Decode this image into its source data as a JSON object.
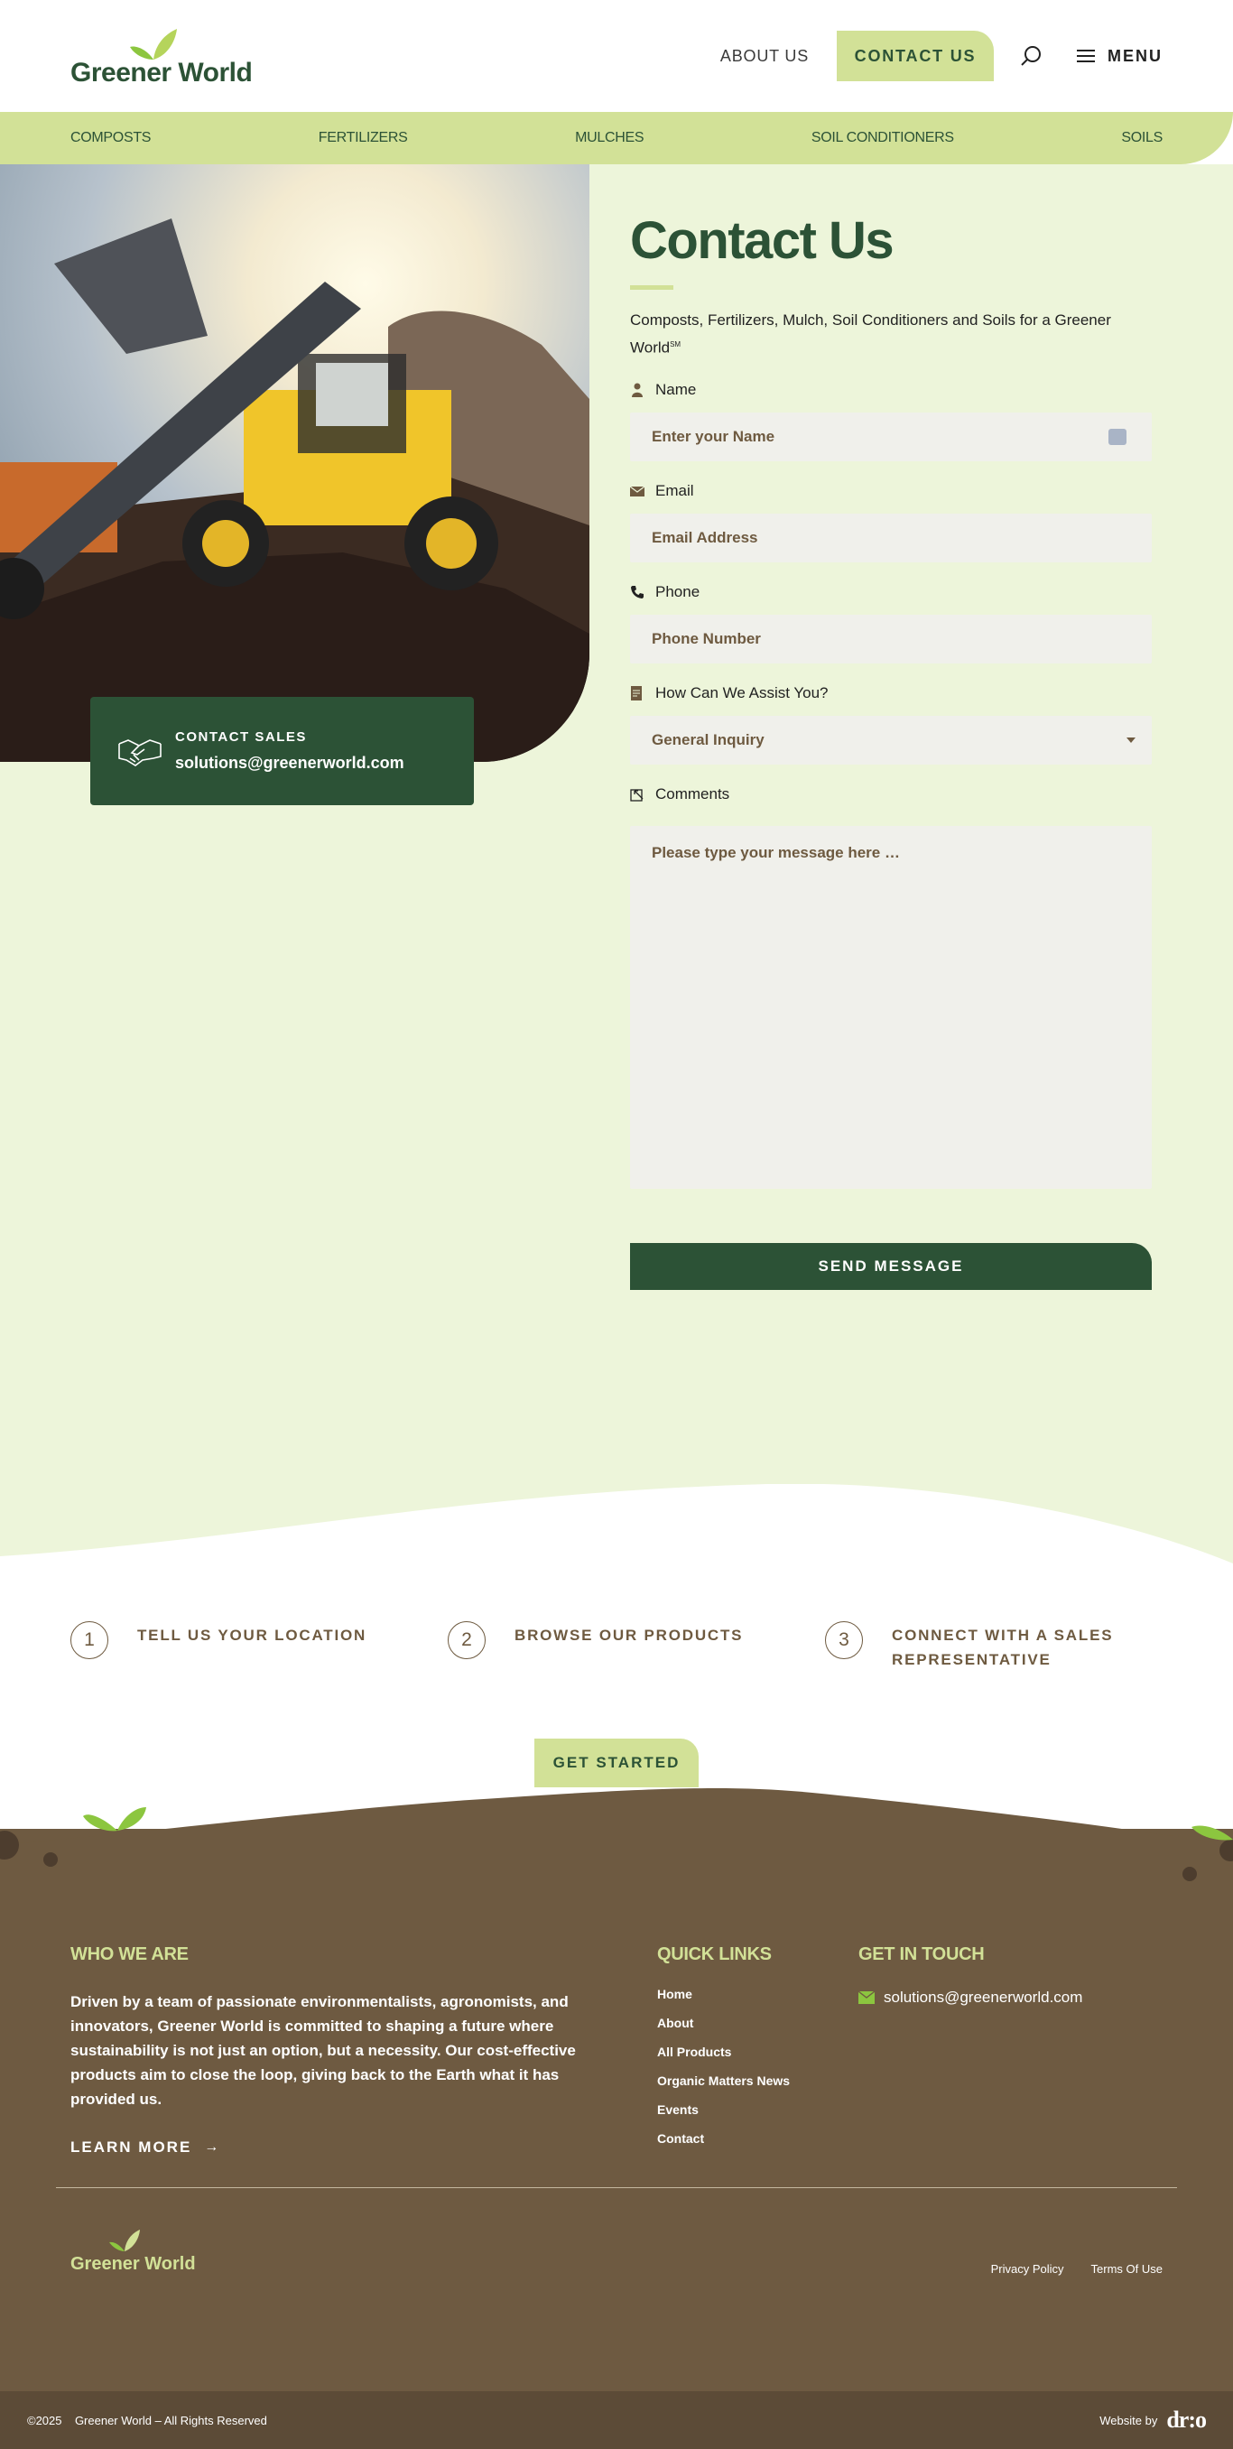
{
  "header": {
    "logo_text": "Greener World",
    "logo_tm": "™",
    "about": "ABOUT US",
    "contact_button": "CONTACT US",
    "menu": "MENU"
  },
  "categories": [
    "COMPOSTS",
    "FERTILIZERS",
    "MULCHES",
    "SOIL CONDITIONERS",
    "SOILS"
  ],
  "sales": {
    "label": "CONTACT SALES",
    "email": "solutions@greenerworld.com"
  },
  "form": {
    "title": "Contact Us",
    "subtitle": "Composts, Fertilizers, Mulch, Soil Conditioners and Soils for a Greener World",
    "subtitle_mark": "SM",
    "name_label": "Name",
    "name_placeholder": "Enter your Name",
    "email_label": "Email",
    "email_placeholder": "Email Address",
    "phone_label": "Phone",
    "phone_placeholder": "Phone Number",
    "assist_label": "How Can We Assist You?",
    "assist_value": "General Inquiry",
    "comments_label": "Comments",
    "comments_placeholder": "Please type your message here …",
    "send": "SEND MESSAGE"
  },
  "steps": [
    {
      "num": "1",
      "text": "TELL US YOUR LOCATION"
    },
    {
      "num": "2",
      "text": "BROWSE OUR PRODUCTS"
    },
    {
      "num": "3",
      "text": "CONNECT WITH A SALES REPRESENTATIVE"
    }
  ],
  "get_started": "GET STARTED",
  "footer": {
    "who_title": "WHO WE ARE",
    "who_text": "Driven by a team of passionate environmentalists, agronomists, and innovators, Greener World is committed to shaping a future where sustainability is not just an option, but a necessity. Our cost-effective products aim to close the loop, giving back to the Earth what it has provided us.",
    "learn_more": "LEARN MORE",
    "quick_title": "QUICK LINKS",
    "quick_links": [
      "Home",
      "About",
      "All Products",
      "Organic Matters News",
      "Events",
      "Contact"
    ],
    "touch_title": "GET IN TOUCH",
    "touch_email": "solutions@greenerworld.com",
    "logo_text": "Greener World",
    "privacy": "Privacy Policy",
    "terms": "Terms Of Use",
    "copyright": "©2025    Greener World – All Rights Reserved",
    "website_by": "Website by",
    "agency": "dr:o"
  },
  "colors": {
    "green_dark": "#2c5236",
    "green_light": "#d2e197",
    "bg_light": "#edf5da",
    "brown": "#6e5a41"
  }
}
